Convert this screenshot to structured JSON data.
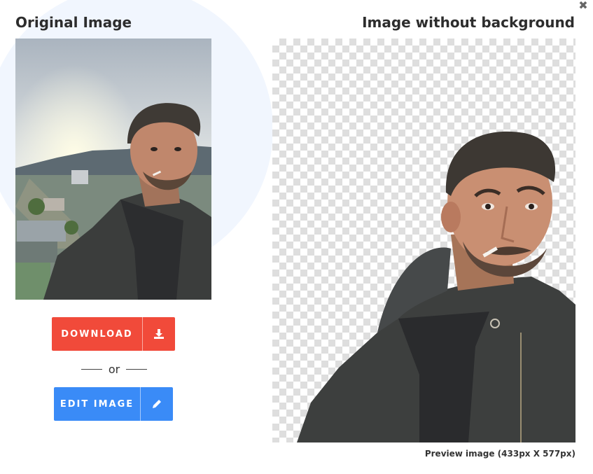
{
  "modal": {
    "original_title": "Original Image",
    "result_title": "Image without background",
    "close_icon": "close-icon",
    "close_glyph": "✖"
  },
  "actions": {
    "download_label": "DOWNLOAD",
    "download_icon": "download-icon",
    "or_text": "or",
    "edit_label": "EDIT IMAGE",
    "edit_icon": "pencil-icon"
  },
  "preview": {
    "caption": "Preview image (433px X 577px)"
  },
  "colors": {
    "download": "#f14a3a",
    "edit": "#3a8bf7",
    "checker": "#dedede"
  }
}
